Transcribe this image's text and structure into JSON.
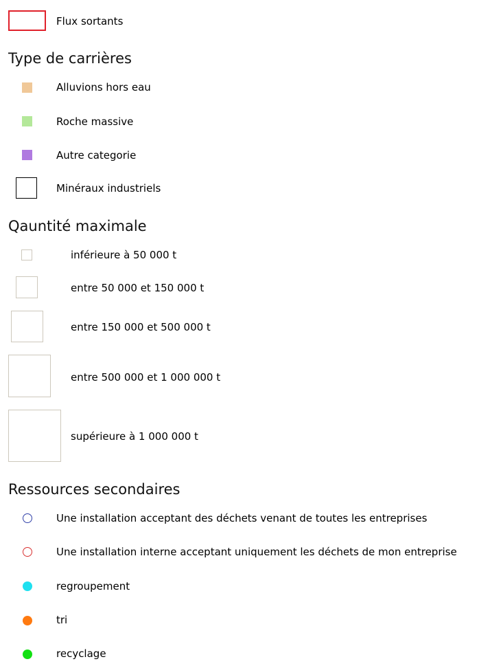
{
  "flux": {
    "label": "Flux sortants",
    "color": "#e0202a"
  },
  "type_carrieres": {
    "title": "Type de carrières",
    "items": [
      {
        "label": "Alluvions hors eau",
        "color": "#f0c898"
      },
      {
        "label": "Roche massive",
        "color": "#b4e89a"
      },
      {
        "label": "Autre categorie",
        "color": "#b07ae0"
      },
      {
        "label": "Minéraux industriels",
        "color": "#000000"
      }
    ]
  },
  "quantite": {
    "title": "Qauntité maximale",
    "items": [
      {
        "label": "inférieure à 50 000 t"
      },
      {
        "label": "entre 50 000 et 150 000 t"
      },
      {
        "label": "entre 150 000 et 500 000 t"
      },
      {
        "label": "entre 500 000 et 1 000 000 t"
      },
      {
        "label": "supérieure à  1 000 000 t"
      }
    ],
    "border_color": "#cdc8bc"
  },
  "ressources": {
    "title": "Ressources secondaires",
    "items": [
      {
        "label": "Une installation acceptant des déchets venant de toutes les entreprises",
        "color": "#3040a8",
        "style": "outline"
      },
      {
        "label": "Une installation interne acceptant uniquement les déchets de mon entreprise",
        "color": "#d83030",
        "style": "outline"
      },
      {
        "label": "regroupement",
        "color": "#1ee0f0",
        "style": "filled"
      },
      {
        "label": "tri",
        "color": "#ff7a10",
        "style": "filled"
      },
      {
        "label": "recyclage",
        "color": "#12e012",
        "style": "filled"
      }
    ]
  }
}
